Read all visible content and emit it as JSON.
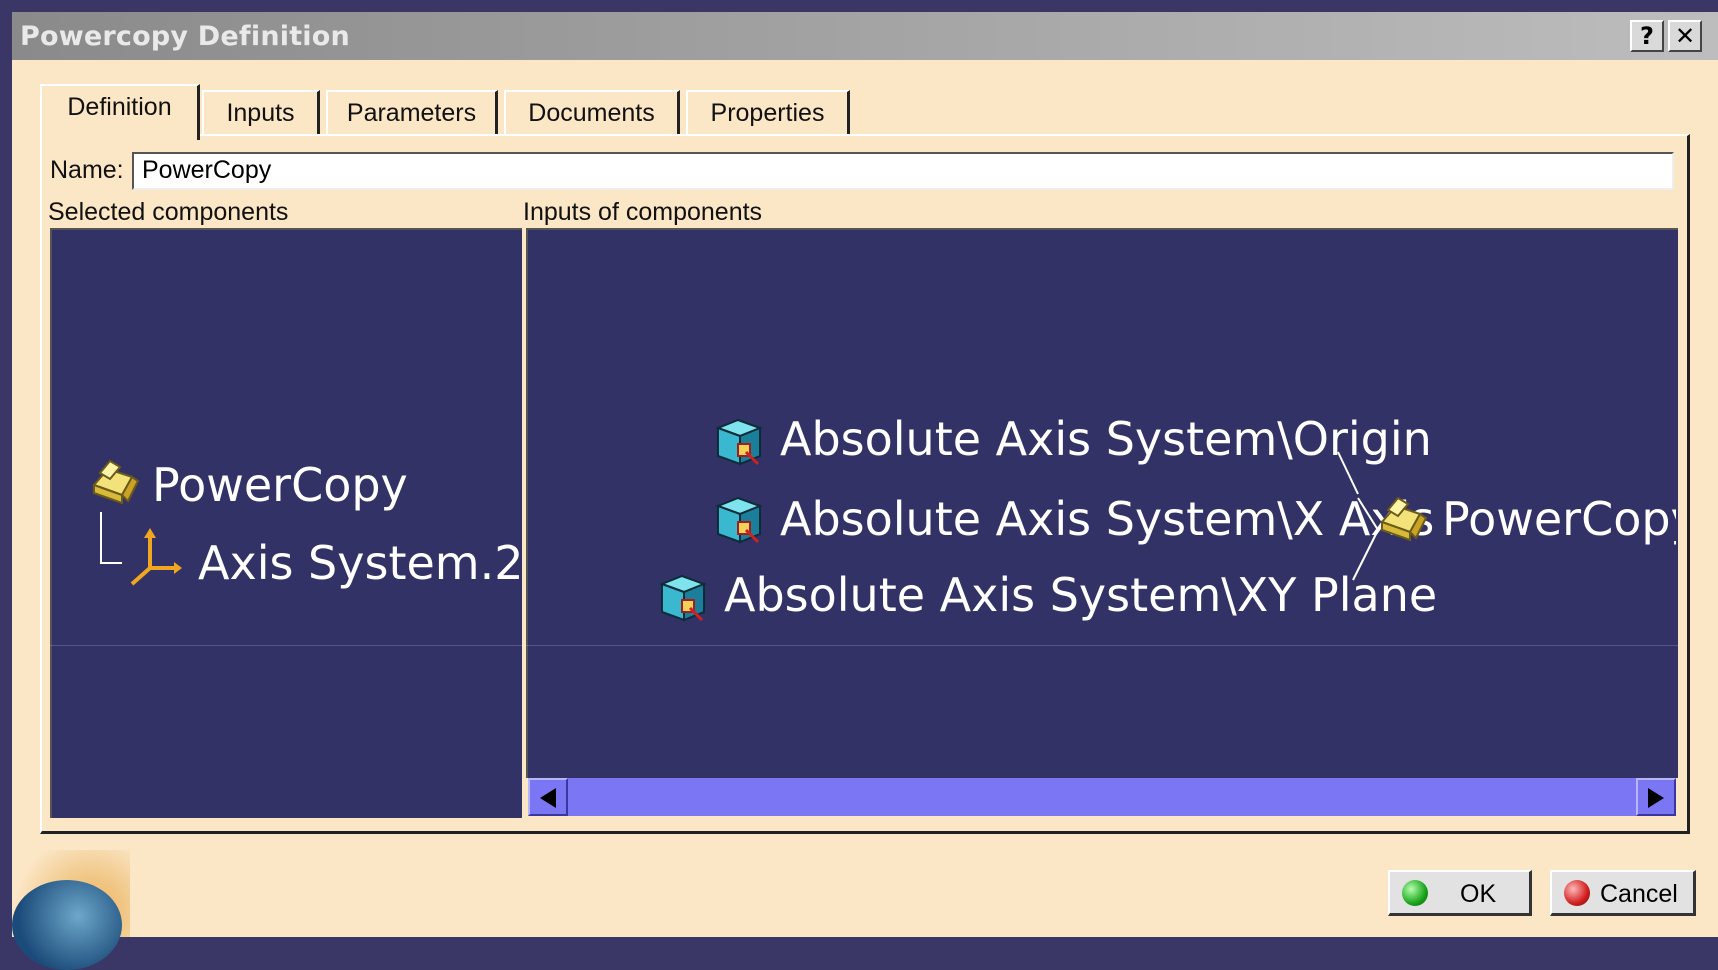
{
  "window": {
    "title": "Powercopy Definition",
    "help_label": "?",
    "close_label": "✕"
  },
  "tabs": [
    {
      "label": "Definition",
      "active": true
    },
    {
      "label": "Inputs"
    },
    {
      "label": "Parameters"
    },
    {
      "label": "Documents"
    },
    {
      "label": "Properties"
    }
  ],
  "form": {
    "name_label": "Name:",
    "name_value": "PowerCopy"
  },
  "selected_components": {
    "label": "Selected components",
    "root": {
      "label": "PowerCopy",
      "icon": "powercopy-icon"
    },
    "child": {
      "label": "Axis System.2",
      "icon": "axis-system-icon"
    }
  },
  "inputs_of_components": {
    "label": "Inputs of components",
    "inputs": [
      {
        "label": "Absolute Axis System\\Origin",
        "icon": "input-cube-icon"
      },
      {
        "label": "Absolute Axis System\\X Axis",
        "icon": "input-cube-icon"
      },
      {
        "label": "Absolute Axis System\\XY Plane",
        "icon": "input-cube-icon"
      }
    ],
    "target": {
      "label": "PowerCopy",
      "icon": "powercopy-icon"
    }
  },
  "buttons": {
    "ok": "OK",
    "cancel": "Cancel"
  },
  "colors": {
    "viewer_bg": "#333266",
    "dialog_bg": "#fbe6c6",
    "scrollbar": "#7b76f4",
    "ok_bulb": "#1aa51a",
    "cancel_bulb": "#d11f1f"
  }
}
